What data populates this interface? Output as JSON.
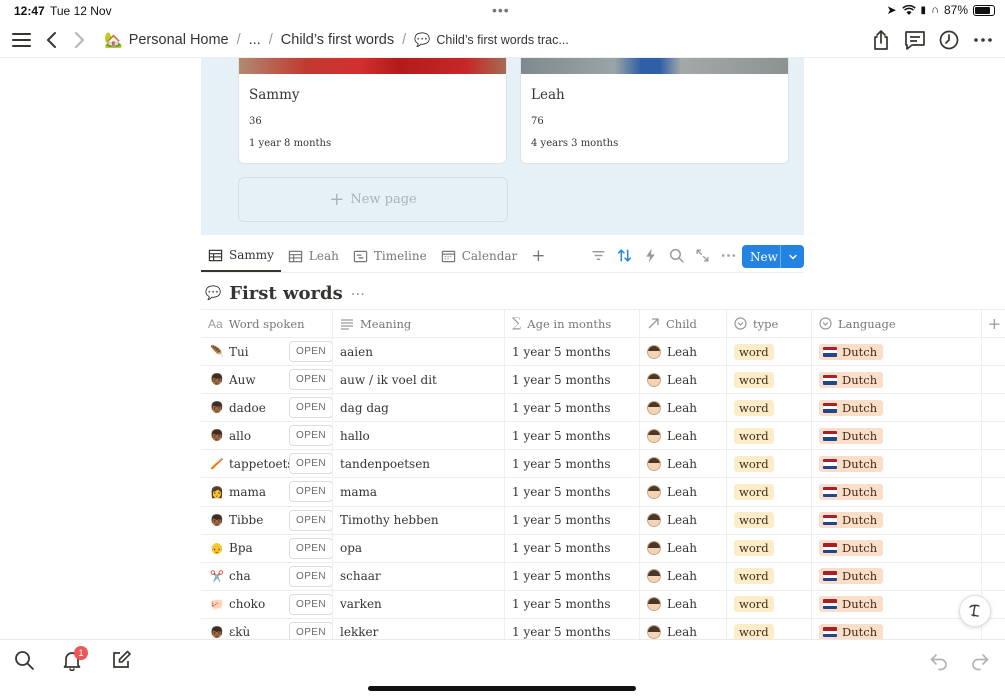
{
  "status": {
    "time": "12:47",
    "date": "Tue 12 Nov",
    "battery": "87%"
  },
  "breadcrumb": {
    "items": [
      "Personal Home",
      "...",
      "Child’s first words",
      "Child’s first words trac..."
    ],
    "home_icon": "house-icon",
    "page_icon": "speech-bubble-icon"
  },
  "gallery": {
    "cards": [
      {
        "name": "Sammy",
        "count": "36",
        "age": "1 year 8 months"
      },
      {
        "name": "Leah",
        "count": "76",
        "age": "4 years 3 months"
      }
    ],
    "new_page": "New page"
  },
  "tabs": [
    {
      "label": "Sammy",
      "icon": "table-icon",
      "active": true
    },
    {
      "label": "Leah",
      "icon": "table-icon",
      "active": false
    },
    {
      "label": "Timeline",
      "icon": "timeline-icon",
      "active": false
    },
    {
      "label": "Calendar",
      "icon": "calendar-icon",
      "active": false
    }
  ],
  "toolbar": {
    "new_label": "New"
  },
  "database": {
    "title": "First words",
    "more": "···"
  },
  "columns": {
    "word": {
      "label": "Word spoken",
      "icon": "Aa"
    },
    "meaning": {
      "label": "Meaning"
    },
    "age": {
      "label": "Age in months"
    },
    "child": {
      "label": "Child"
    },
    "type": {
      "label": "type"
    },
    "language": {
      "label": "Language"
    }
  },
  "open_label": "OPEN",
  "rows": [
    {
      "icon": "🪶",
      "word": "Tui",
      "meaning": "aaien",
      "age": "1 year 5 months",
      "child": "Leah",
      "type": "word",
      "language": "Dutch"
    },
    {
      "icon": "👦🏾",
      "word": "Auw",
      "meaning": "auw / ik voel dit",
      "age": "1 year 5 months",
      "child": "Leah",
      "type": "word",
      "language": "Dutch"
    },
    {
      "icon": "👦🏾",
      "word": "dadoe",
      "meaning": "dag dag",
      "age": "1 year 5 months",
      "child": "Leah",
      "type": "word",
      "language": "Dutch"
    },
    {
      "icon": "👦🏾",
      "word": "allo",
      "meaning": "hallo",
      "age": "1 year 5 months",
      "child": "Leah",
      "type": "word",
      "language": "Dutch"
    },
    {
      "icon": "🪥",
      "word": "tappetoetsen",
      "meaning": "tandenpoetsen",
      "age": "1 year 5 months",
      "child": "Leah",
      "type": "word",
      "language": "Dutch"
    },
    {
      "icon": "👩",
      "word": "mama",
      "meaning": "mama",
      "age": "1 year 5 months",
      "child": "Leah",
      "type": "word",
      "language": "Dutch"
    },
    {
      "icon": "👦🏾",
      "word": "Tibbe",
      "meaning": "Timothy hebben",
      "age": "1 year 5 months",
      "child": "Leah",
      "type": "word",
      "language": "Dutch"
    },
    {
      "icon": "👴",
      "word": "Bpa",
      "meaning": "opa",
      "age": "1 year 5 months",
      "child": "Leah",
      "type": "word",
      "language": "Dutch"
    },
    {
      "icon": "✂️",
      "word": "cha",
      "meaning": "schaar",
      "age": "1 year 5 months",
      "child": "Leah",
      "type": "word",
      "language": "Dutch"
    },
    {
      "icon": "🐖",
      "word": "choko",
      "meaning": "varken",
      "age": "1 year 5 months",
      "child": "Leah",
      "type": "word",
      "language": "Dutch"
    },
    {
      "icon": "👦🏾",
      "word": "ɛkù",
      "meaning": "lekker",
      "age": "1 year 5 months",
      "child": "Leah",
      "type": "word",
      "language": "Dutch"
    }
  ],
  "notifications": {
    "count": "1"
  },
  "colors": {
    "accent": "#2383e2",
    "gallery_bg": "#e6f1f7",
    "word_badge": "#fdecc8",
    "language_badge": "#fadec9"
  }
}
